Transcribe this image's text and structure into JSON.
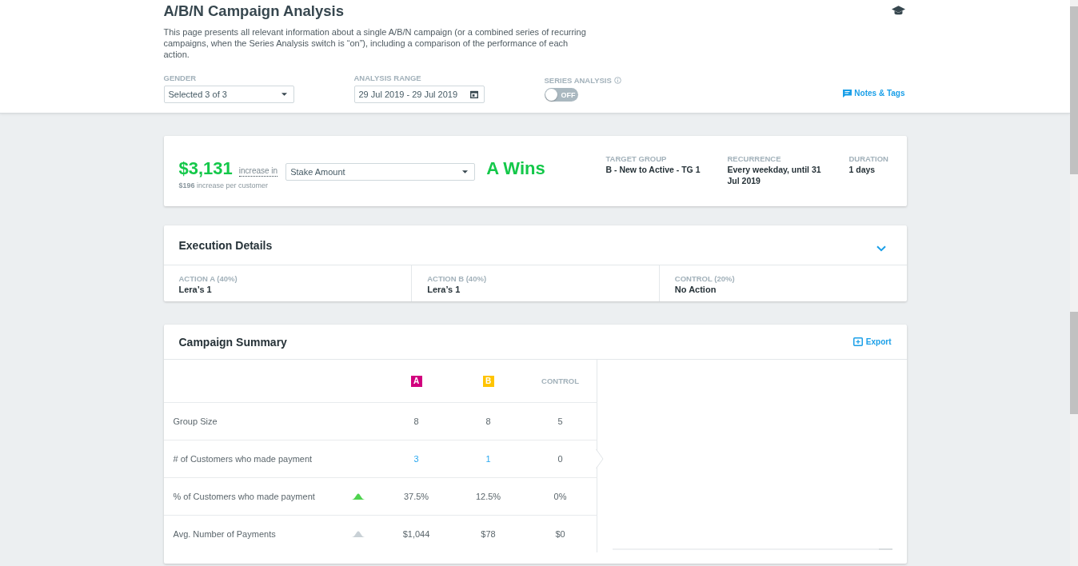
{
  "header": {
    "title": "A/B/N Campaign Analysis",
    "description": "This page presents all relevant information about a single A/B/N campaign (or a combined series of recurring campaigns, when the Series Analysis switch is “on”), including a comparison of the performance of each action.",
    "filters": [
      {
        "kind": "dropdown",
        "label": "GENDER",
        "value": "Selected 3 of 3"
      },
      {
        "kind": "date",
        "label": "ANALYSIS RANGE",
        "value": "29 Jul 2019 - 29 Jul 2019"
      },
      {
        "kind": "toggle",
        "label": "SERIES ANALYSIS",
        "on": false,
        "state_text": "OFF"
      }
    ],
    "notes_link": "Notes & Tags"
  },
  "result": {
    "amount": "$3,131",
    "change_label": "increase in",
    "metric": "Stake Amount",
    "verdict": "A Wins",
    "per_customer": "**$196** increase per customer",
    "details": [
      {
        "label": "TARGET GROUP",
        "value": "B - New to Active - TG 1"
      },
      {
        "label": "RECURRENCE",
        "value": "Every weekday, until 31 Jul 2019"
      },
      {
        "label": "DURATION",
        "value": "1 days"
      }
    ]
  },
  "execution": {
    "title": "Execution Details",
    "actions": [
      {
        "label": "ACTION A (40%)",
        "value": "Lera’s 1"
      },
      {
        "label": "ACTION B (40%)",
        "value": "Lera’s 1"
      },
      {
        "label": "CONTROL (20%)",
        "value": "No Action"
      }
    ]
  },
  "summary": {
    "title": "Campaign Summary",
    "export": "Export",
    "columns": [
      {
        "kind": "tag",
        "label": "A",
        "color": "#d1007e"
      },
      {
        "kind": "tag",
        "label": "B",
        "color": "#ffc400"
      },
      {
        "kind": "text",
        "label": "CONTROL"
      }
    ],
    "rows": [
      {
        "label": "Group Size",
        "selected": false,
        "cells": [
          {
            "value": "8",
            "link": false
          },
          {
            "value": "8",
            "link": false
          },
          {
            "value": "5",
            "link": false
          }
        ]
      },
      {
        "label": "# of Customers who made payment",
        "selected": true,
        "cells": [
          {
            "value": "3",
            "link": true
          },
          {
            "value": "1",
            "link": true
          },
          {
            "value": "0",
            "link": false
          }
        ]
      },
      {
        "label": "% of Customers who made payment",
        "selected": false,
        "significant": true,
        "cells": [
          {
            "value": "37.5%",
            "link": false
          },
          {
            "value": "12.5%",
            "link": false
          },
          {
            "value": "0%",
            "link": false
          }
        ]
      },
      {
        "label": "Avg. Number of Payments",
        "selected": false,
        "significant": false,
        "cells": [
          {
            "value": "$1,044",
            "link": false
          },
          {
            "value": "$78",
            "link": false
          },
          {
            "value": "$0",
            "link": false
          }
        ]
      }
    ]
  }
}
